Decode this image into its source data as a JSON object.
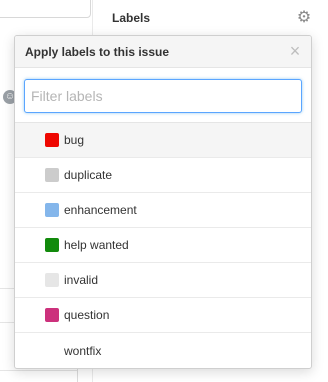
{
  "sidebar": {
    "title": "Labels",
    "gear_icon": "gear-icon"
  },
  "popover": {
    "title": "Apply labels to this issue",
    "close_icon": "close-icon",
    "filter_placeholder": "Filter labels",
    "filter_value": "",
    "labels": [
      {
        "name": "bug",
        "color": "#ee0701",
        "selected": true
      },
      {
        "name": "duplicate",
        "color": "#cccccc",
        "selected": false
      },
      {
        "name": "enhancement",
        "color": "#84b6eb",
        "selected": false
      },
      {
        "name": "help wanted",
        "color": "#128a0c",
        "selected": false
      },
      {
        "name": "invalid",
        "color": "#e6e6e6",
        "selected": false
      },
      {
        "name": "question",
        "color": "#cc317c",
        "selected": false
      },
      {
        "name": "wontfix",
        "color": "#ffffff",
        "selected": false
      }
    ]
  },
  "focus_color": "#5aa5ff"
}
